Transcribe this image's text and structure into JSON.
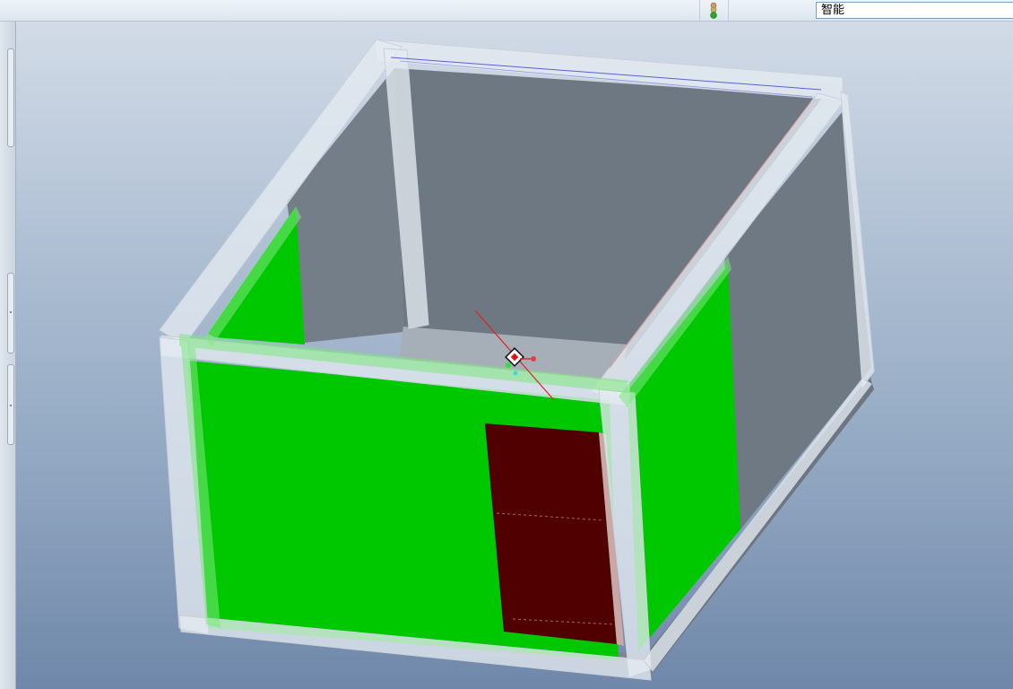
{
  "toolbar": {
    "status_light_icon": "traffic-light-icon",
    "filter_value": "智能"
  },
  "viewport": {
    "model_colors": {
      "wall_green": "#00c800",
      "frame_white": "#e4eaf1",
      "inner_wall_gray": "#6e7882",
      "door_maroon": "#510000",
      "floor_gray": "#a6afb8",
      "base_shadow": "#7c8590"
    },
    "icons": [
      "coordinate-system-icon",
      "rotation-center-icon"
    ]
  }
}
